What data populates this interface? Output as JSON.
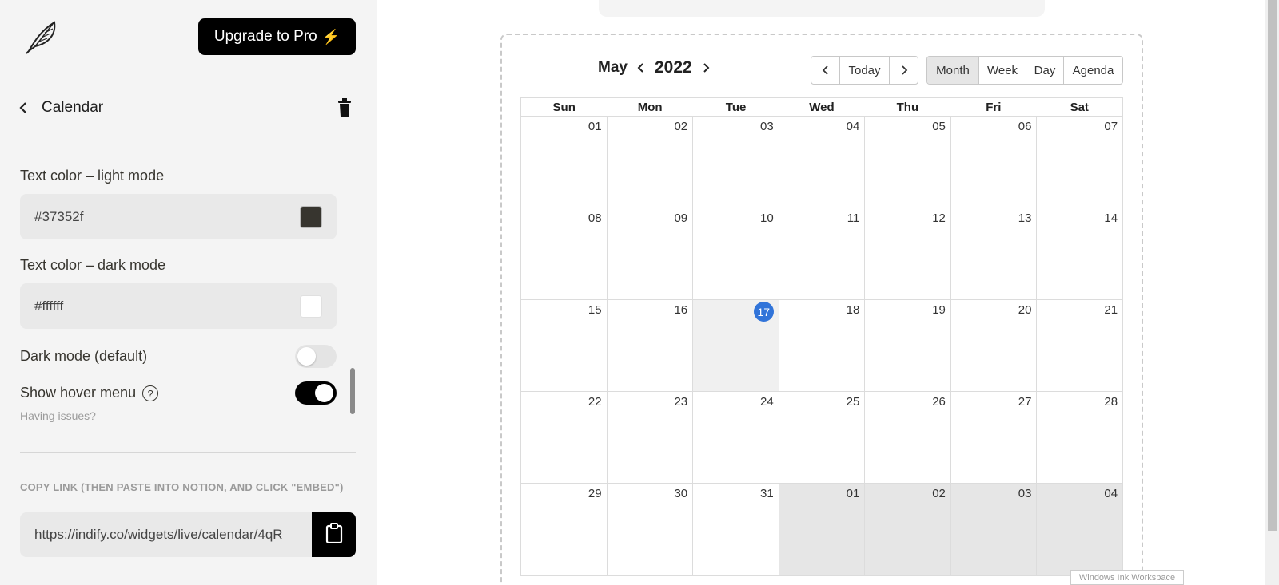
{
  "sidebar": {
    "upgrade_label": "Upgrade to Pro",
    "upgrade_emoji": "⚡",
    "back_title": "Calendar",
    "light_label": "Text color – light mode",
    "light_value": "#37352f",
    "light_swatch": "#37352f",
    "dark_label": "Text color – dark mode",
    "dark_value": "#ffffff",
    "dark_swatch": "#ffffff",
    "dark_mode_label": "Dark mode (default)",
    "dark_mode_on": false,
    "hover_menu_label": "Show hover menu",
    "hover_menu_on": true,
    "help_glyph": "?",
    "having_issues": "Having issues?",
    "copy_label": "COPY LINK (THEN PASTE INTO NOTION, AND CLICK \"EMBED\")",
    "link_value": "https://indify.co/widgets/live/calendar/4qR"
  },
  "calendar": {
    "month": "May",
    "year": "2022",
    "nav_today": "Today",
    "views": [
      "Month",
      "Week",
      "Day",
      "Agenda"
    ],
    "active_view": "Month",
    "dow": [
      "Sun",
      "Mon",
      "Tue",
      "Wed",
      "Thu",
      "Fri",
      "Sat"
    ],
    "today": "17",
    "weeks": [
      [
        "01",
        "02",
        "03",
        "04",
        "05",
        "06",
        "07"
      ],
      [
        "08",
        "09",
        "10",
        "11",
        "12",
        "13",
        "14"
      ],
      [
        "15",
        "16",
        "17",
        "18",
        "19",
        "20",
        "21"
      ],
      [
        "22",
        "23",
        "24",
        "25",
        "26",
        "27",
        "28"
      ],
      [
        "29",
        "30",
        "31",
        "01",
        "02",
        "03",
        "04"
      ]
    ]
  },
  "system": {
    "ink_workspace": "Windows Ink Workspace"
  },
  "icons": {
    "logo": "feather-icon",
    "back": "chevron-left-icon",
    "delete": "trash-icon",
    "copy": "clipboard-icon"
  }
}
